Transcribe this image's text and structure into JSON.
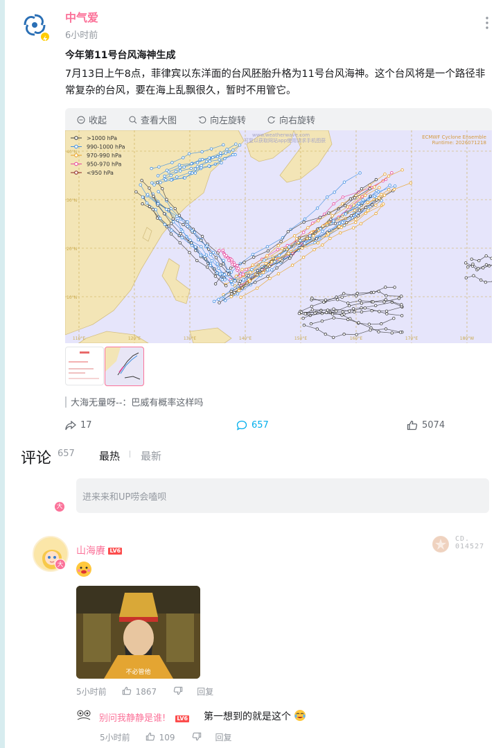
{
  "post": {
    "author": "中气爱",
    "time": "6小时前",
    "title": "今年第11号台风海神生成",
    "body": "7月13日上午8点，菲律宾以东洋面的台风胚胎升格为11号台风海神。这个台风将是一个路径非常复杂的台风，要在海上乱飘很久，暂时不用管它。",
    "toolbar": {
      "collapse": "收起",
      "view_large": "查看大图",
      "rotate_left": "向左旋转",
      "rotate_right": "向右旋转"
    },
    "map": {
      "legend": [
        ">1000 hPa",
        "990-1000 hPa",
        "970-990 hPa",
        "950-970 hPa",
        "<950 hPa"
      ],
      "legend_colors": [
        "#3a3a3a",
        "#3d8de0",
        "#e9a020",
        "#e8449a",
        "#8a1f1f"
      ],
      "source_title": "ECMWF Cyclone Ensemble",
      "runtime": "Runtime: 2026071218",
      "watermark": "www.weatherwave.com",
      "watermark2": "可复以获取网站app使用请求手机图获",
      "lat_labels": [
        "40°N",
        "30°N",
        "20°N",
        "10°N"
      ],
      "lon_labels": [
        "110°E",
        "120°E",
        "130°E",
        "140°E",
        "150°E",
        "160°E",
        "170°E",
        "180°W"
      ]
    },
    "forward_comment": "大海无量呀--：巴威有概率这样吗",
    "stats": {
      "share": "17",
      "comments": "657",
      "likes": "5074"
    }
  },
  "comments_section": {
    "heading": "评论",
    "count": "657",
    "sort_hot": "最热",
    "sort_new": "最新",
    "reply_placeholder": "进来来和UP唠会嗑呗",
    "mini_badge": "大"
  },
  "comment": {
    "user": "山海賡",
    "level": "LV6",
    "avatar_badge": "大",
    "image_caption": "不必管他",
    "time": "5小时前",
    "likes": "1867",
    "reply_label": "回复",
    "stamp_lines": [
      "CD.",
      "014527"
    ]
  },
  "sub_comment": {
    "user": "别问我静静是谁!",
    "level": "LV6",
    "text": "第一想到的就是这个",
    "time": "5小时前",
    "likes": "109",
    "reply_label": "回复"
  }
}
